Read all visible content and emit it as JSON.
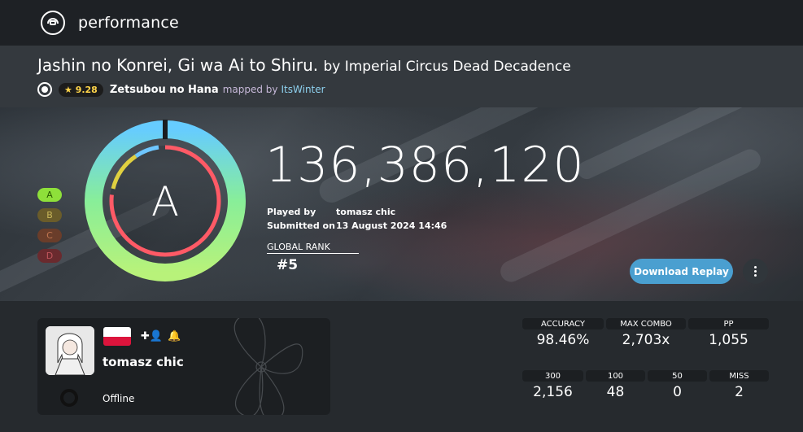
{
  "header": {
    "title": "performance",
    "logo_icon": "osu-logo-icon"
  },
  "beatmap": {
    "title": "Jashin no Konrei, Gi wa Ai to Shiru.",
    "artist_prefix": "by Imperial Circus Dead Decadence",
    "star_rating": "★ 9.28",
    "difficulty": "Zetsubou no Hana",
    "mapped_by_label": "mapped by",
    "mapper": "ItsWinter"
  },
  "score": {
    "total": "136,386,120",
    "grade": "A",
    "grades": [
      "A",
      "B",
      "C",
      "D"
    ],
    "played_by_label": "Played by",
    "played_by": "tomasz chic",
    "submitted_label": "Submitted on",
    "submitted": "13 August 2024 14:46",
    "global_rank_label": "GLOBAL RANK",
    "global_rank": "#5",
    "accuracy_fraction": 0.9846,
    "download_label": "Download Replay"
  },
  "user": {
    "name": "tomasz chic",
    "status": "Offline",
    "country": "Poland"
  },
  "stats": {
    "accuracy": {
      "label": "ACCURACY",
      "value": "98.46%"
    },
    "max_combo": {
      "label": "MAX COMBO",
      "value": "2,703x"
    },
    "pp": {
      "label": "PP",
      "value": "1,055"
    },
    "c300": {
      "label": "300",
      "value": "2,156"
    },
    "c100": {
      "label": "100",
      "value": "48"
    },
    "c50": {
      "label": "50",
      "value": "0"
    },
    "miss": {
      "label": "MISS",
      "value": "2"
    }
  },
  "colors": {
    "accent_blue": "#4a9fd0",
    "grade_a": "#8ee03a",
    "star_gold": "#ffd54a",
    "mapper_blue": "#8ed1ef"
  }
}
